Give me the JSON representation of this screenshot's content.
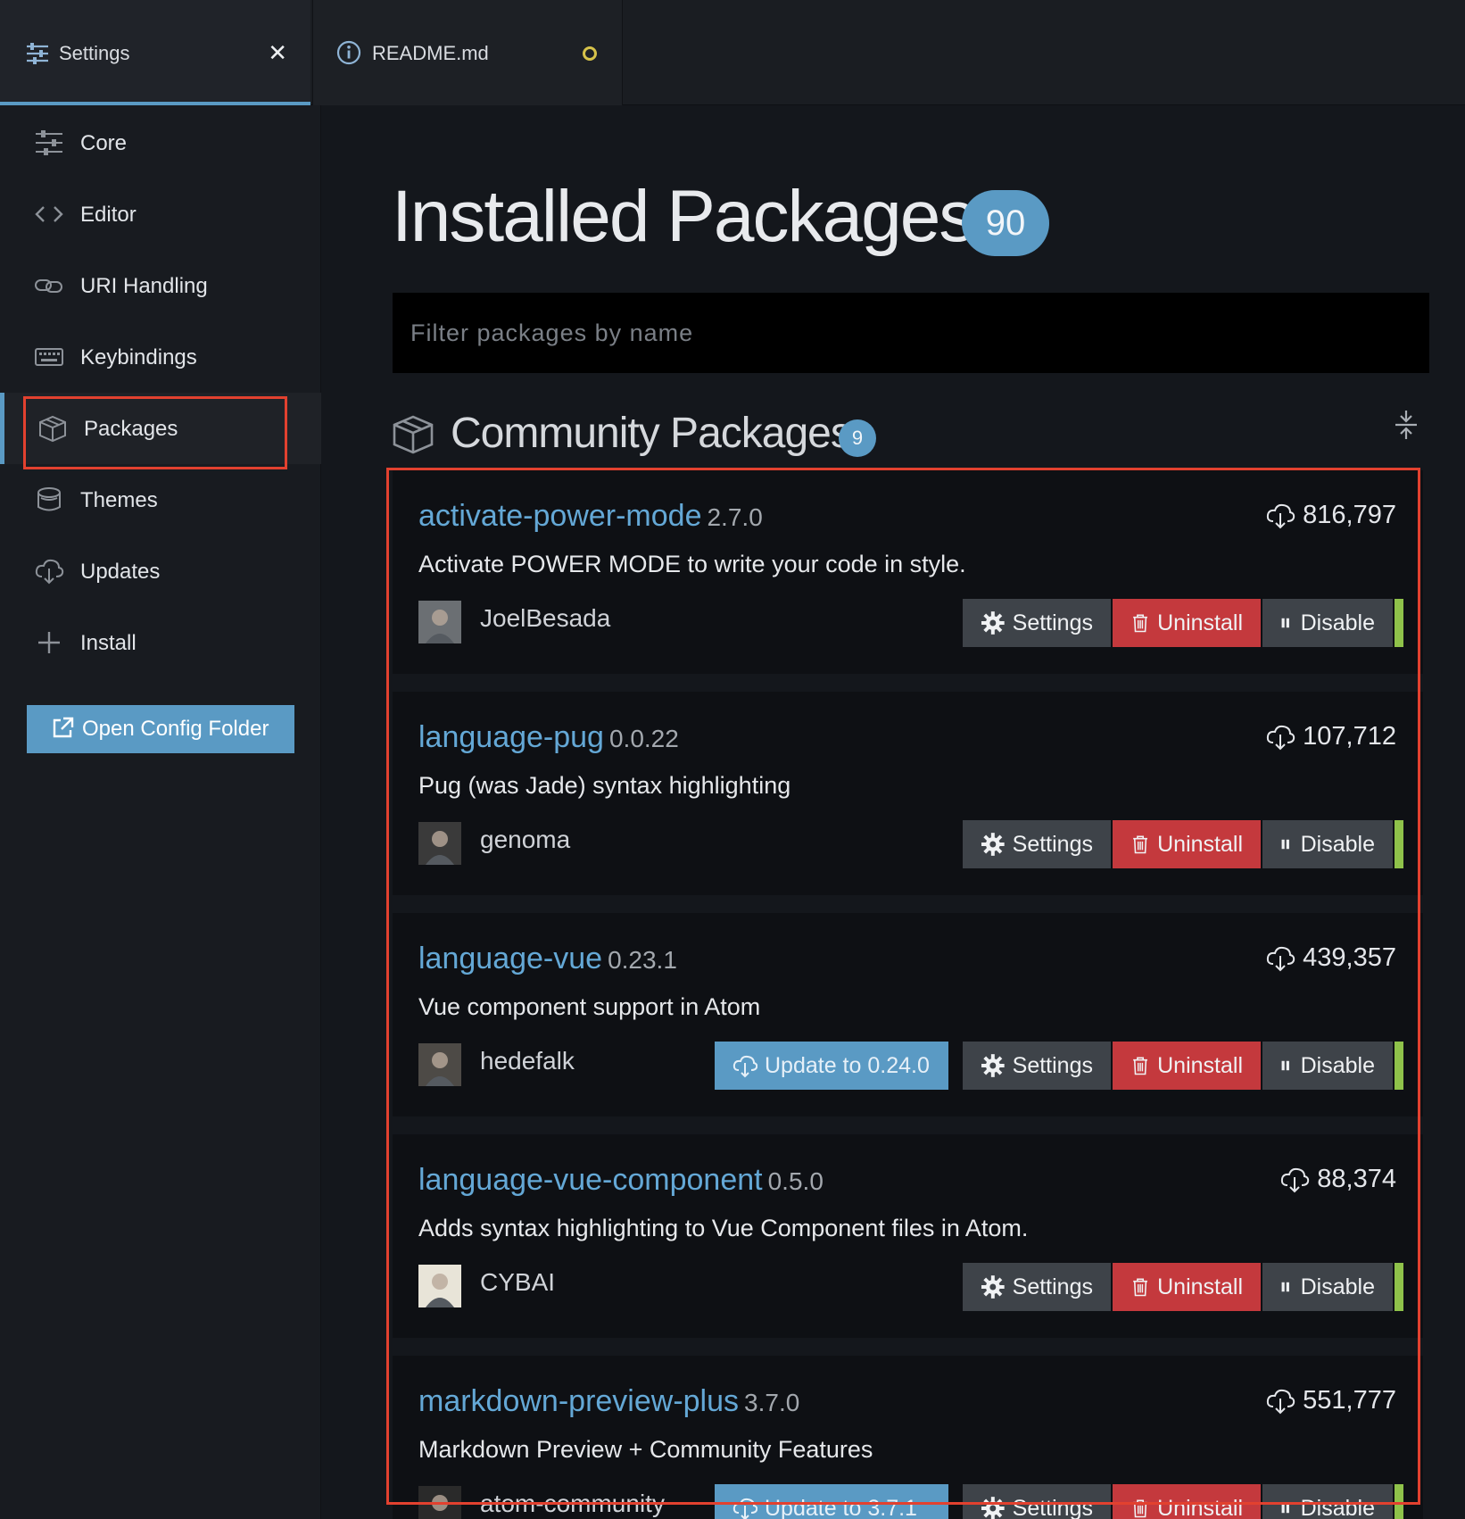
{
  "tabs": [
    {
      "label": "Settings",
      "icon": "sliders-icon",
      "closable": true
    },
    {
      "label": "README.md",
      "icon": "info-icon",
      "modified": true
    }
  ],
  "sidebar": {
    "items": [
      {
        "label": "Core",
        "icon": "sliders-icon"
      },
      {
        "label": "Editor",
        "icon": "code-icon"
      },
      {
        "label": "URI Handling",
        "icon": "link-icon"
      },
      {
        "label": "Keybindings",
        "icon": "keyboard-icon"
      },
      {
        "label": "Packages",
        "icon": "package-icon",
        "active": true
      },
      {
        "label": "Themes",
        "icon": "paintcan-icon"
      },
      {
        "label": "Updates",
        "icon": "cloud-download-icon"
      },
      {
        "label": "Install",
        "icon": "plus-icon"
      }
    ],
    "config_button": "Open Config Folder"
  },
  "main": {
    "title": "Installed Packages",
    "title_count": "90",
    "filter_placeholder": "Filter packages by name",
    "section_title": "Community Packages",
    "section_count": "9"
  },
  "packages": [
    {
      "name": "activate-power-mode",
      "version": "2.7.0",
      "downloads": "816,797",
      "description": "Activate POWER MODE to write your code in style.",
      "author": "JoelBesada",
      "update": ""
    },
    {
      "name": "language-pug",
      "version": "0.0.22",
      "downloads": "107,712",
      "description": "Pug (was Jade) syntax highlighting",
      "author": "genoma",
      "update": ""
    },
    {
      "name": "language-vue",
      "version": "0.23.1",
      "downloads": "439,357",
      "description": "Vue component support in Atom",
      "author": "hedefalk",
      "update": "Update to 0.24.0"
    },
    {
      "name": "language-vue-component",
      "version": "0.5.0",
      "downloads": "88,374",
      "description": "Adds syntax highlighting to Vue Component files in Atom.",
      "author": "CYBAI",
      "update": ""
    },
    {
      "name": "markdown-preview-plus",
      "version": "3.7.0",
      "downloads": "551,777",
      "description": "Markdown Preview + Community Features",
      "author": "atom-community",
      "update": "Update to 3.7.1"
    }
  ],
  "buttons": {
    "settings": "Settings",
    "uninstall": "Uninstall",
    "disable": "Disable"
  },
  "colors": {
    "accent": "#5a9ac4",
    "danger": "#c4393d",
    "enabled": "#8fc24a",
    "highlight": "#e2412f",
    "link": "#64a8d6"
  }
}
